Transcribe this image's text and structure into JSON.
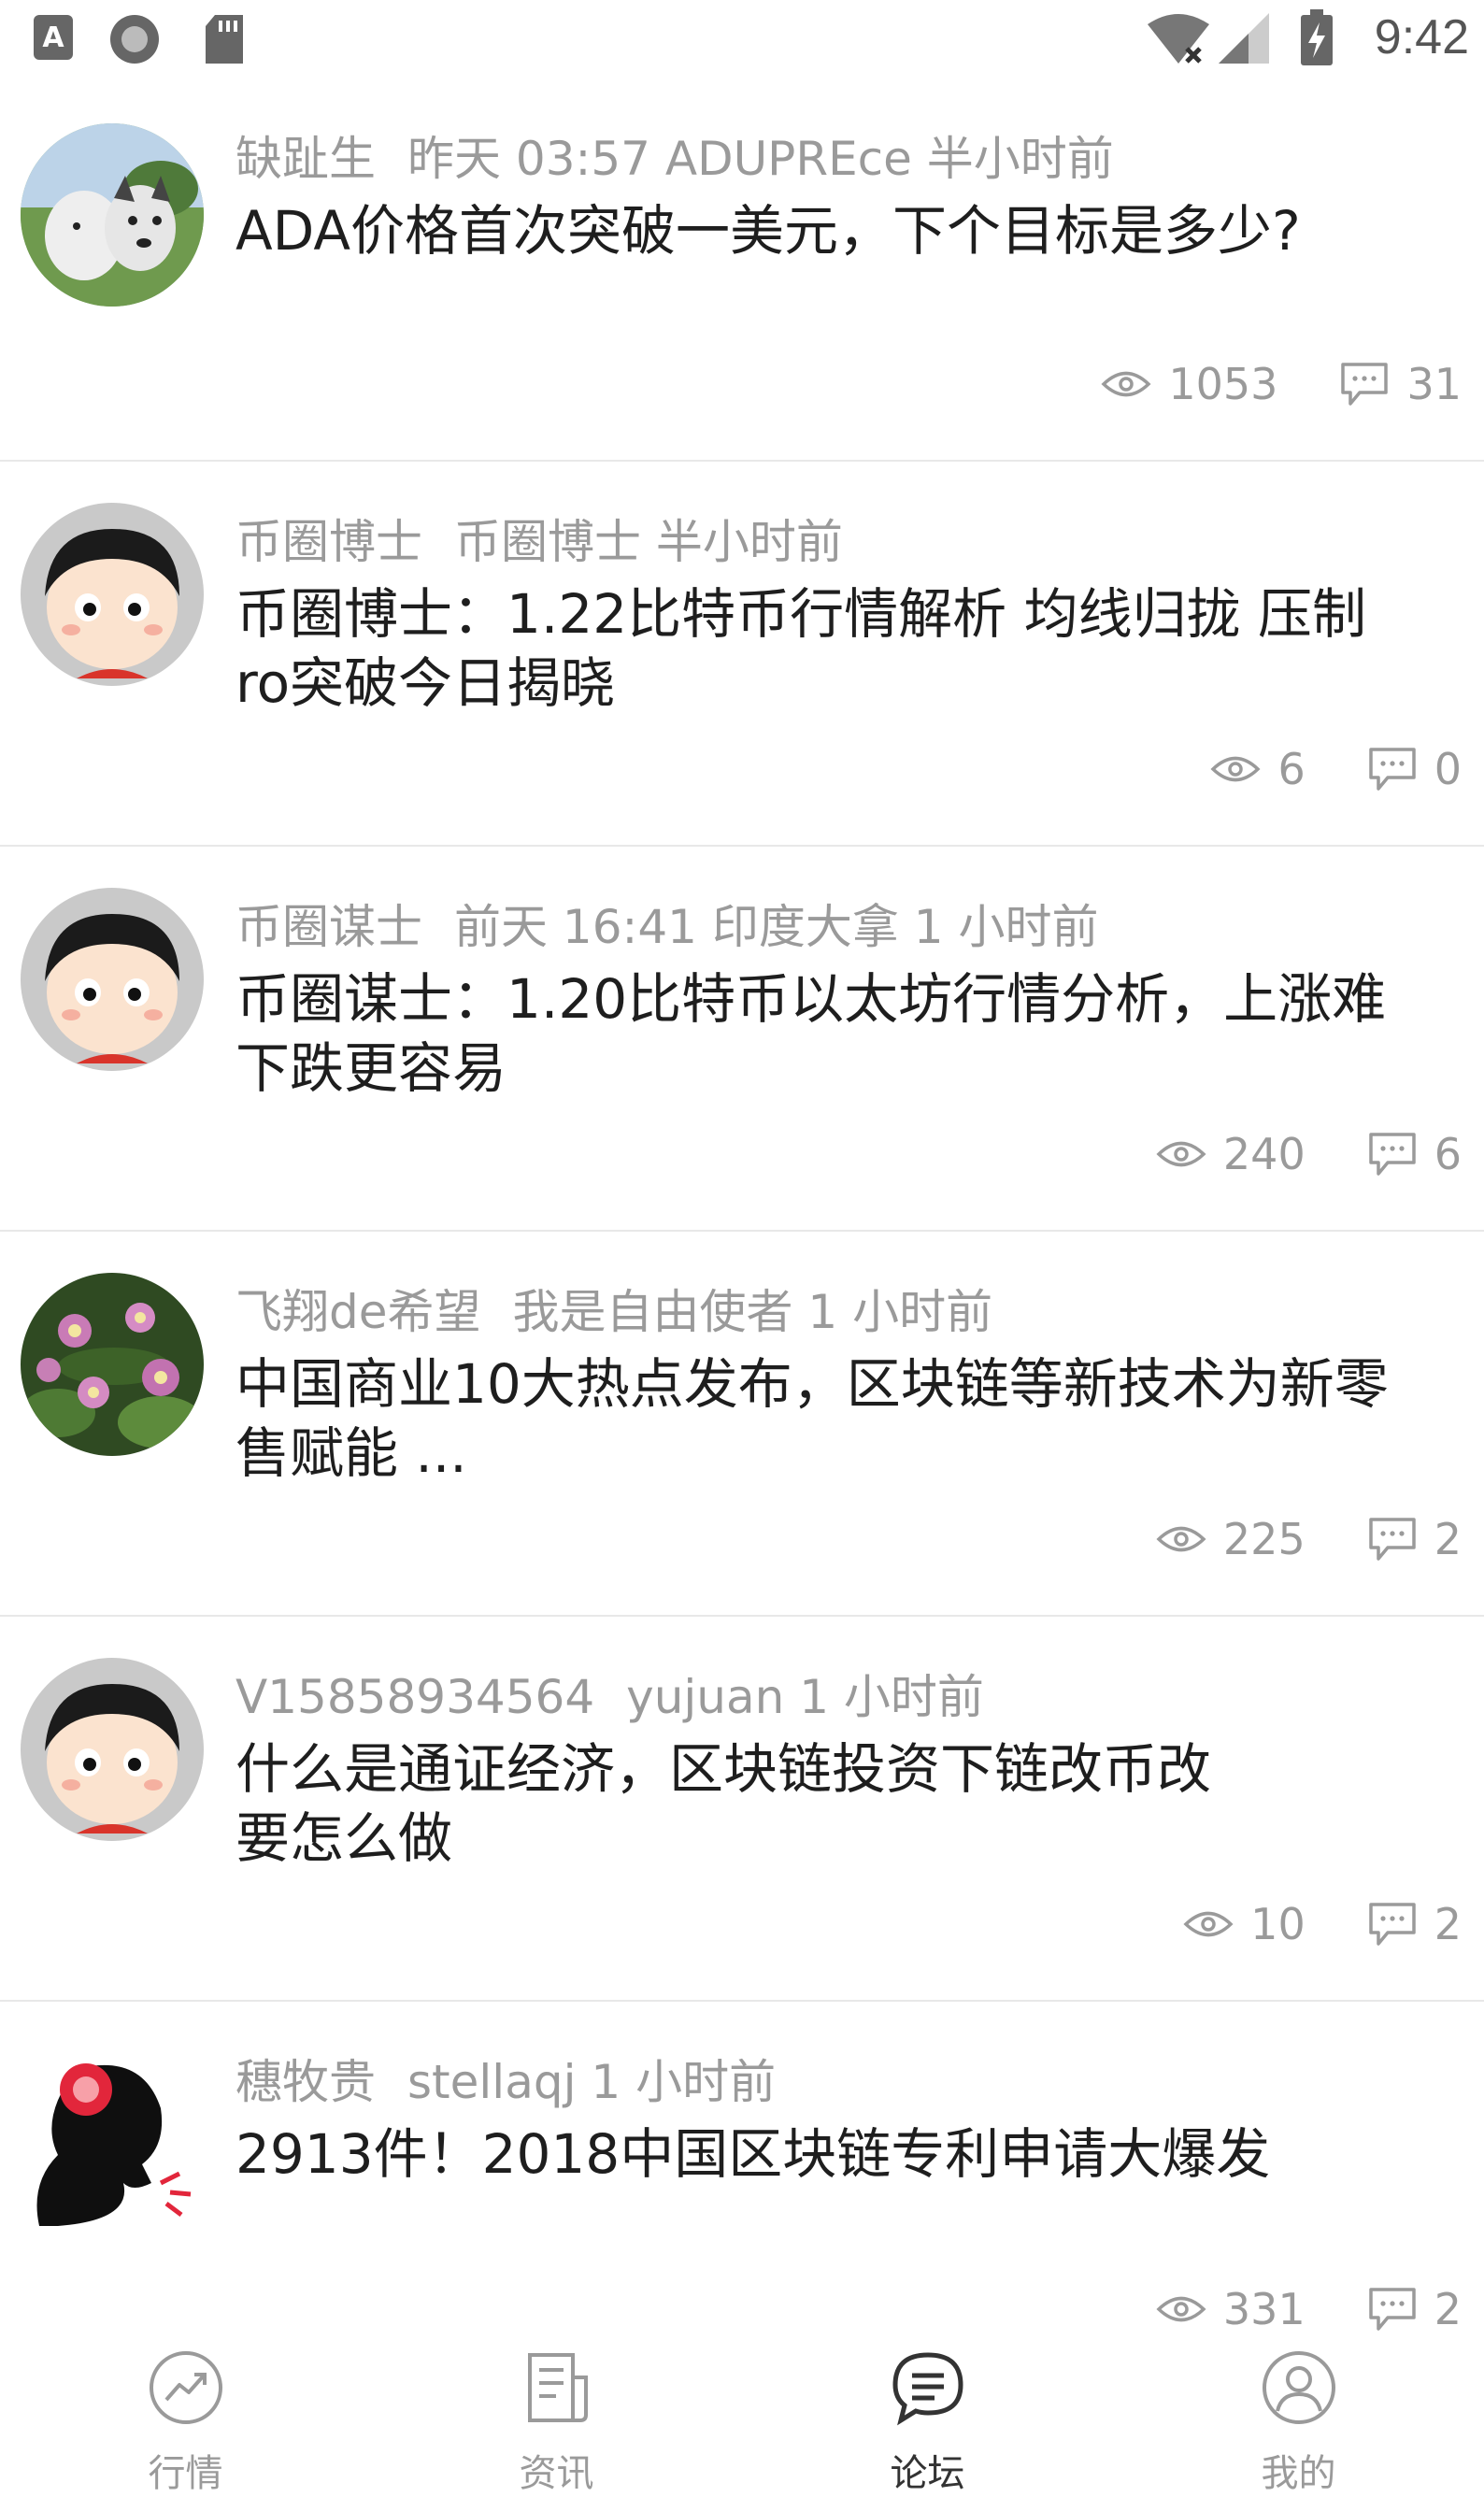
{
  "status_bar": {
    "time": "9:42"
  },
  "posts": [
    {
      "author": "缺趾生",
      "meta": "昨天 03:57 ADUPREce 半小时前",
      "title": "ADA价格首次突破一美元，下个目标是多少?",
      "views": "1053",
      "comments": "31"
    },
    {
      "author": "币圈博士",
      "meta": "币圈博士 半小时前",
      "title": "币圈博士：1.22比特币行情解析 均线归拢 压制ro突破今日揭晓",
      "views": "6",
      "comments": "0"
    },
    {
      "author": "币圈谋士",
      "meta": "前天 16:41 印度大拿 1 小时前",
      "title": "币圈谋士：1.20比特币以太坊行情分析，上涨难下跌更容易",
      "views": "240",
      "comments": "6"
    },
    {
      "author": "飞翔de希望",
      "meta": "我是自由使者 1 小时前",
      "title": "中国商业10大热点发布，区块链等新技术为新零售赋能 ...",
      "views": "225",
      "comments": "2"
    },
    {
      "author": "V15858934564",
      "meta": "yujuan 1 小时前",
      "title": "什么是通证经济，区块链投资下链改币改要怎么做",
      "views": "10",
      "comments": "2"
    },
    {
      "author": "穗牧贵",
      "meta": "stellaqj 1 小时前",
      "title": "2913件！2018中国区块链专利申请大爆发",
      "views": "331",
      "comments": "2"
    }
  ],
  "tabbar": {
    "tabs": [
      {
        "label": "行情",
        "icon": "trend-chart-icon",
        "active": false
      },
      {
        "label": "资讯",
        "icon": "news-document-icon",
        "active": false
      },
      {
        "label": "论坛",
        "icon": "forum-chat-icon",
        "active": true
      },
      {
        "label": "我的",
        "icon": "user-profile-icon",
        "active": false
      }
    ]
  }
}
